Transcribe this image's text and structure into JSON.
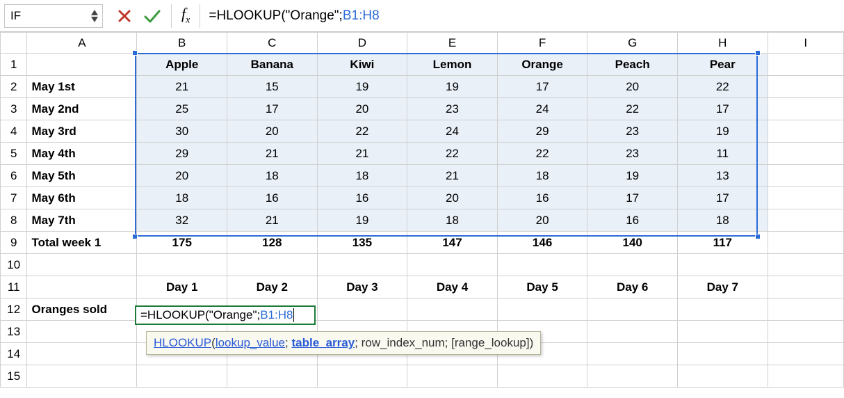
{
  "formula_bar": {
    "namebox_value": "IF",
    "formula_text_prefix": "=HLOOKUP(\"Orange\";",
    "formula_text_ref": "B1:H8"
  },
  "headers": {
    "cols": [
      "A",
      "B",
      "C",
      "D",
      "E",
      "F",
      "G",
      "H",
      "I"
    ]
  },
  "row_numbers": [
    "1",
    "2",
    "3",
    "4",
    "5",
    "6",
    "7",
    "8",
    "9",
    "10",
    "11",
    "12",
    "13",
    "14",
    "15"
  ],
  "data": {
    "fruits": [
      "Apple",
      "Banana",
      "Kiwi",
      "Lemon",
      "Orange",
      "Peach",
      "Pear"
    ],
    "rows": [
      {
        "label": "May 1st",
        "vals": [
          "21",
          "15",
          "19",
          "19",
          "17",
          "20",
          "22"
        ]
      },
      {
        "label": "May 2nd",
        "vals": [
          "25",
          "17",
          "20",
          "23",
          "24",
          "22",
          "17"
        ]
      },
      {
        "label": "May 3rd",
        "vals": [
          "30",
          "20",
          "22",
          "24",
          "29",
          "23",
          "19"
        ]
      },
      {
        "label": "May 4th",
        "vals": [
          "29",
          "21",
          "21",
          "22",
          "22",
          "23",
          "11"
        ]
      },
      {
        "label": "May 5th",
        "vals": [
          "20",
          "18",
          "18",
          "21",
          "18",
          "19",
          "13"
        ]
      },
      {
        "label": "May 6th",
        "vals": [
          "18",
          "16",
          "16",
          "20",
          "16",
          "17",
          "17"
        ]
      },
      {
        "label": "May 7th",
        "vals": [
          "32",
          "21",
          "19",
          "18",
          "20",
          "16",
          "18"
        ]
      }
    ],
    "total_label": "Total week 1",
    "totals": [
      "175",
      "128",
      "135",
      "147",
      "146",
      "140",
      "117"
    ],
    "days_label_row": [
      "Day 1",
      "Day 2",
      "Day 3",
      "Day 4",
      "Day 5",
      "Day 6",
      "Day 7"
    ],
    "oranges_label": "Oranges sold",
    "cell_edit_prefix": "=HLOOKUP(\"Orange\";",
    "cell_edit_ref": "B1:H8"
  },
  "tooltip": {
    "fn": "HLOOKUP",
    "p1": "lookup_value",
    "p2": "table_array",
    "p3": "row_index_num",
    "p4": "[range_lookup]"
  }
}
